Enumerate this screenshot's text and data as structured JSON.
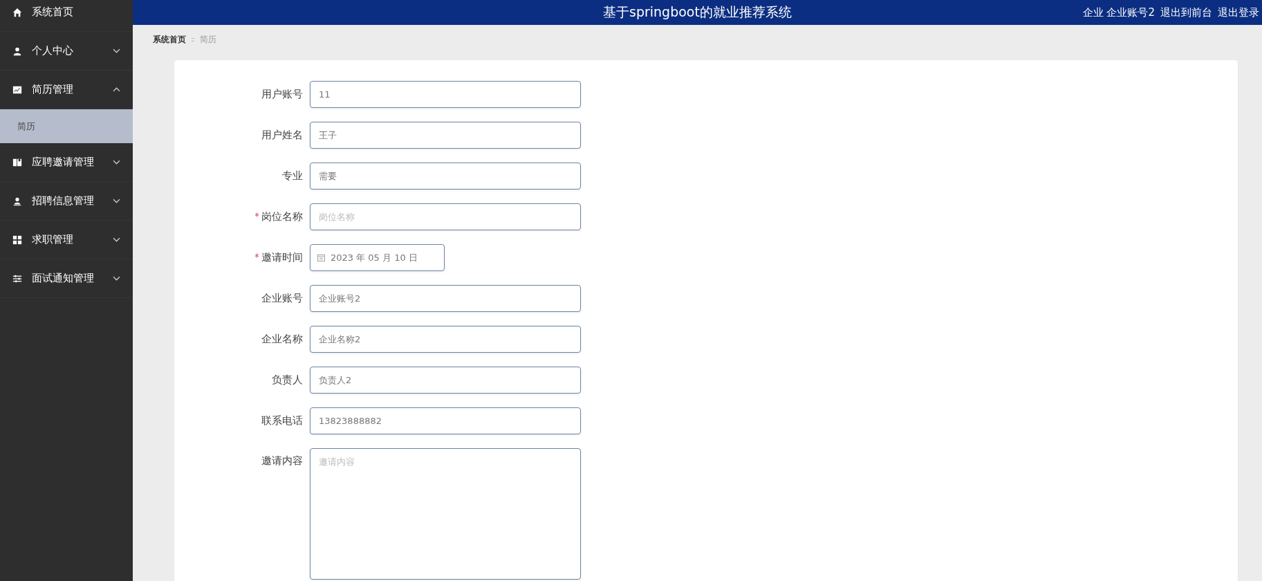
{
  "sidebar": {
    "items": [
      {
        "label": "系统首页",
        "selected": false
      },
      {
        "label": "个人中心",
        "selected": false,
        "expanded": false
      },
      {
        "label": "简历管理",
        "selected": false,
        "expanded": true,
        "children": [
          {
            "label": "简历",
            "selected": true
          }
        ]
      },
      {
        "label": "应聘邀请管理",
        "selected": false,
        "expanded": false
      },
      {
        "label": "招聘信息管理",
        "selected": false,
        "expanded": false
      },
      {
        "label": "求职管理",
        "selected": false,
        "expanded": false
      },
      {
        "label": "面试通知管理",
        "selected": false,
        "expanded": false
      }
    ]
  },
  "header": {
    "title": "基于springboot的就业推荐系统",
    "user": "企业 企业账号2",
    "links": [
      "退出到前台",
      "退出登录"
    ]
  },
  "breadcrumb": [
    {
      "label": "系统首页",
      "selected": false
    },
    {
      "label": "简历",
      "selected": true
    }
  ],
  "form": {
    "fields": [
      {
        "kind": "text",
        "label": "用户账号",
        "required": false,
        "value": "11"
      },
      {
        "kind": "text",
        "label": "用户姓名",
        "required": false,
        "value": "王子"
      },
      {
        "kind": "text",
        "label": "专业",
        "required": false,
        "value": "需要"
      },
      {
        "kind": "text",
        "label": "岗位名称",
        "required": true,
        "placeholder": "岗位名称"
      },
      {
        "kind": "date",
        "label": "邀请时间",
        "required": true,
        "value": "2023 年 05 月 10 日"
      },
      {
        "kind": "text",
        "label": "企业账号",
        "required": false,
        "value": "企业账号2"
      },
      {
        "kind": "text",
        "label": "企业名称",
        "required": false,
        "value": "企业名称2"
      },
      {
        "kind": "text",
        "label": "负责人",
        "required": false,
        "value": "负责人2"
      },
      {
        "kind": "text",
        "label": "联系电话",
        "required": false,
        "value": "13823888882"
      },
      {
        "kind": "textarea",
        "label": "邀请内容",
        "required": false,
        "placeholder": "邀请内容"
      }
    ]
  }
}
